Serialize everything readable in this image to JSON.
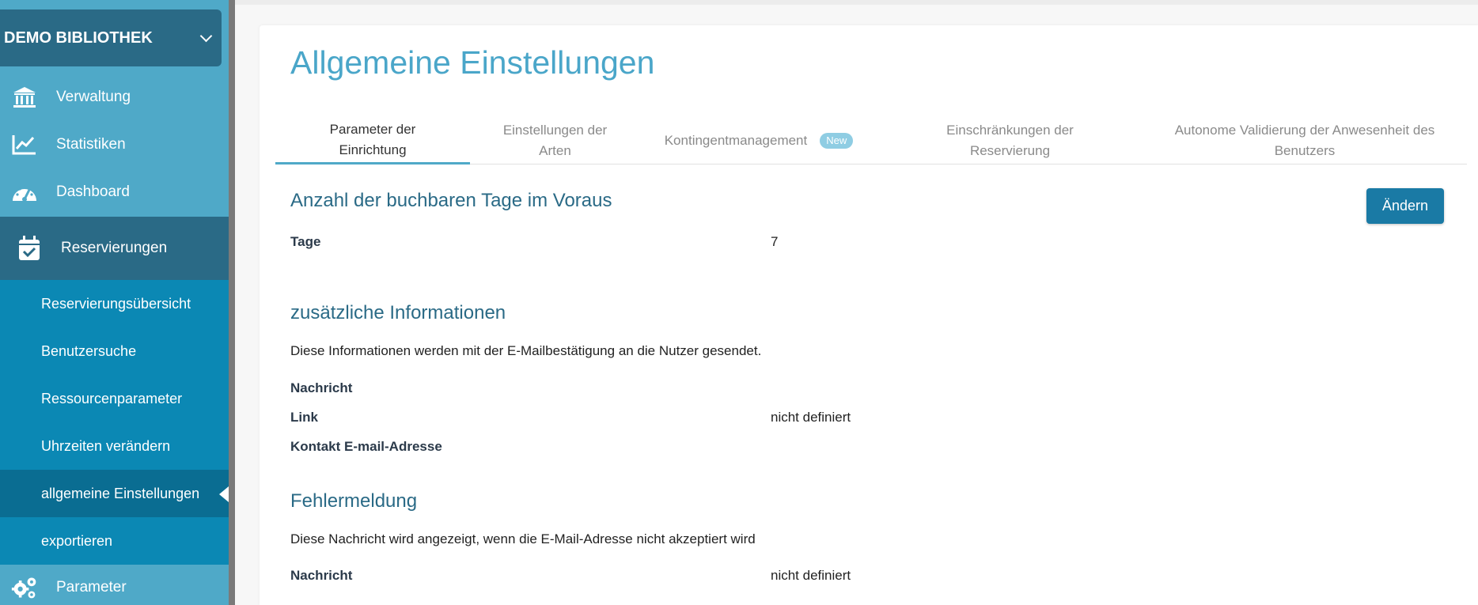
{
  "sidebar": {
    "library_name": "DEMO BIBLIOTHEK",
    "nav": [
      {
        "label": "Verwaltung",
        "icon": "bank-icon"
      },
      {
        "label": "Statistiken",
        "icon": "chart-line-icon"
      },
      {
        "label": "Dashboard",
        "icon": "gauge-icon"
      },
      {
        "label": "Reservierungen",
        "icon": "calendar-check-icon"
      }
    ],
    "submenu": [
      {
        "label": "Reservierungsübersicht"
      },
      {
        "label": "Benutzersuche"
      },
      {
        "label": "Ressourcenparameter"
      },
      {
        "label": "Uhrzeiten verändern"
      },
      {
        "label": "allgemeine Einstellungen"
      },
      {
        "label": "exportieren"
      }
    ],
    "settings": {
      "label": "Parameter",
      "icon": "gears-icon"
    }
  },
  "page": {
    "title": "Allgemeine Einstellungen",
    "tabs": [
      {
        "label": "Parameter der Einrichtung"
      },
      {
        "label": "Einstellungen der Arten"
      },
      {
        "label": "Kontingentmanagement",
        "badge": "New"
      },
      {
        "label": "Einschränkungen der Reservierung"
      },
      {
        "label": "Autonome Validierung der Anwesenheit des Benutzers"
      }
    ],
    "change_button": "Ändern",
    "sections": {
      "advance": {
        "title": "Anzahl der buchbaren Tage im Voraus",
        "days_label": "Tage",
        "days_value": "7"
      },
      "additional": {
        "title": "zusätzliche Informationen",
        "description": "Diese Informationen werden mit der E-Mailbestätigung an die Nutzer gesendet.",
        "message_label": "Nachricht",
        "link_label": "Link",
        "link_value": "nicht definiert",
        "contact_label": "Kontakt E-mail-Adresse"
      },
      "error": {
        "title": "Fehlermeldung",
        "description": "Diese Nachricht wird angezeigt, wenn die E-Mail-Adresse nicht akzeptiert wird",
        "message_label": "Nachricht",
        "message_value": "nicht definiert"
      }
    }
  },
  "colors": {
    "sidebar_bg": "#4fa9c8",
    "sidebar_dark": "#2a6a86",
    "submenu_bg": "#0b88b4",
    "accent": "#4aa6c9",
    "button": "#1a7aa5"
  }
}
